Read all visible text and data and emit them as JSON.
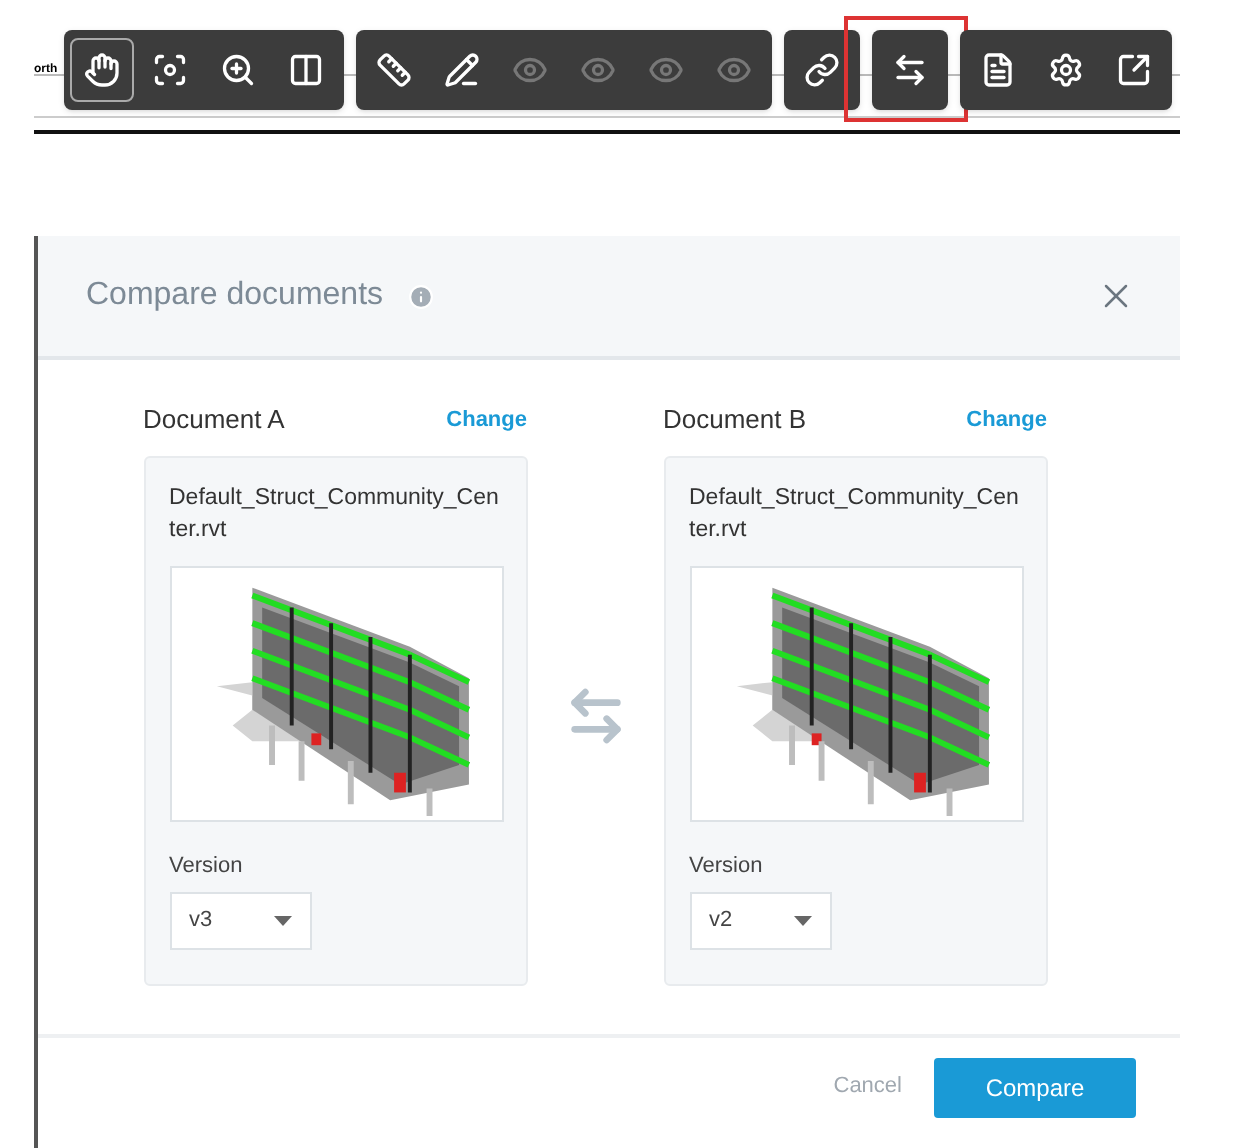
{
  "drawing": {
    "label": "orth"
  },
  "toolbar": {
    "groups": [
      {
        "highlighted": false,
        "tools": [
          {
            "kind": "hand",
            "selected": true,
            "disabled": false
          },
          {
            "kind": "focus",
            "selected": false,
            "disabled": false
          },
          {
            "kind": "zoom",
            "selected": false,
            "disabled": false
          },
          {
            "kind": "split",
            "selected": false,
            "disabled": false
          }
        ]
      },
      {
        "highlighted": false,
        "tools": [
          {
            "kind": "ruler",
            "selected": false,
            "disabled": false
          },
          {
            "kind": "markup",
            "selected": false,
            "disabled": false
          },
          {
            "kind": "eye",
            "selected": false,
            "disabled": true
          },
          {
            "kind": "eye",
            "selected": false,
            "disabled": true
          },
          {
            "kind": "eye",
            "selected": false,
            "disabled": true
          },
          {
            "kind": "eye",
            "selected": false,
            "disabled": true
          }
        ]
      },
      {
        "highlighted": false,
        "tools": [
          {
            "kind": "link",
            "selected": false,
            "disabled": false
          }
        ]
      },
      {
        "highlighted": true,
        "tools": [
          {
            "kind": "compare",
            "selected": false,
            "disabled": false
          }
        ]
      },
      {
        "highlighted": false,
        "tools": [
          {
            "kind": "properties",
            "selected": false,
            "disabled": false
          },
          {
            "kind": "settings",
            "selected": false,
            "disabled": false
          },
          {
            "kind": "expand",
            "selected": false,
            "disabled": false
          }
        ]
      }
    ]
  },
  "dialog": {
    "title": "Compare documents",
    "documents": [
      {
        "label": "Document A",
        "action": "Change",
        "file": "Default_Struct_Community_Center.rvt",
        "version_label": "Version",
        "version": "v3"
      },
      {
        "label": "Document B",
        "action": "Change",
        "file": "Default_Struct_Community_Center.rvt",
        "version_label": "Version",
        "version": "v2"
      }
    ],
    "buttons": [
      "Cancel",
      "Compare"
    ]
  }
}
